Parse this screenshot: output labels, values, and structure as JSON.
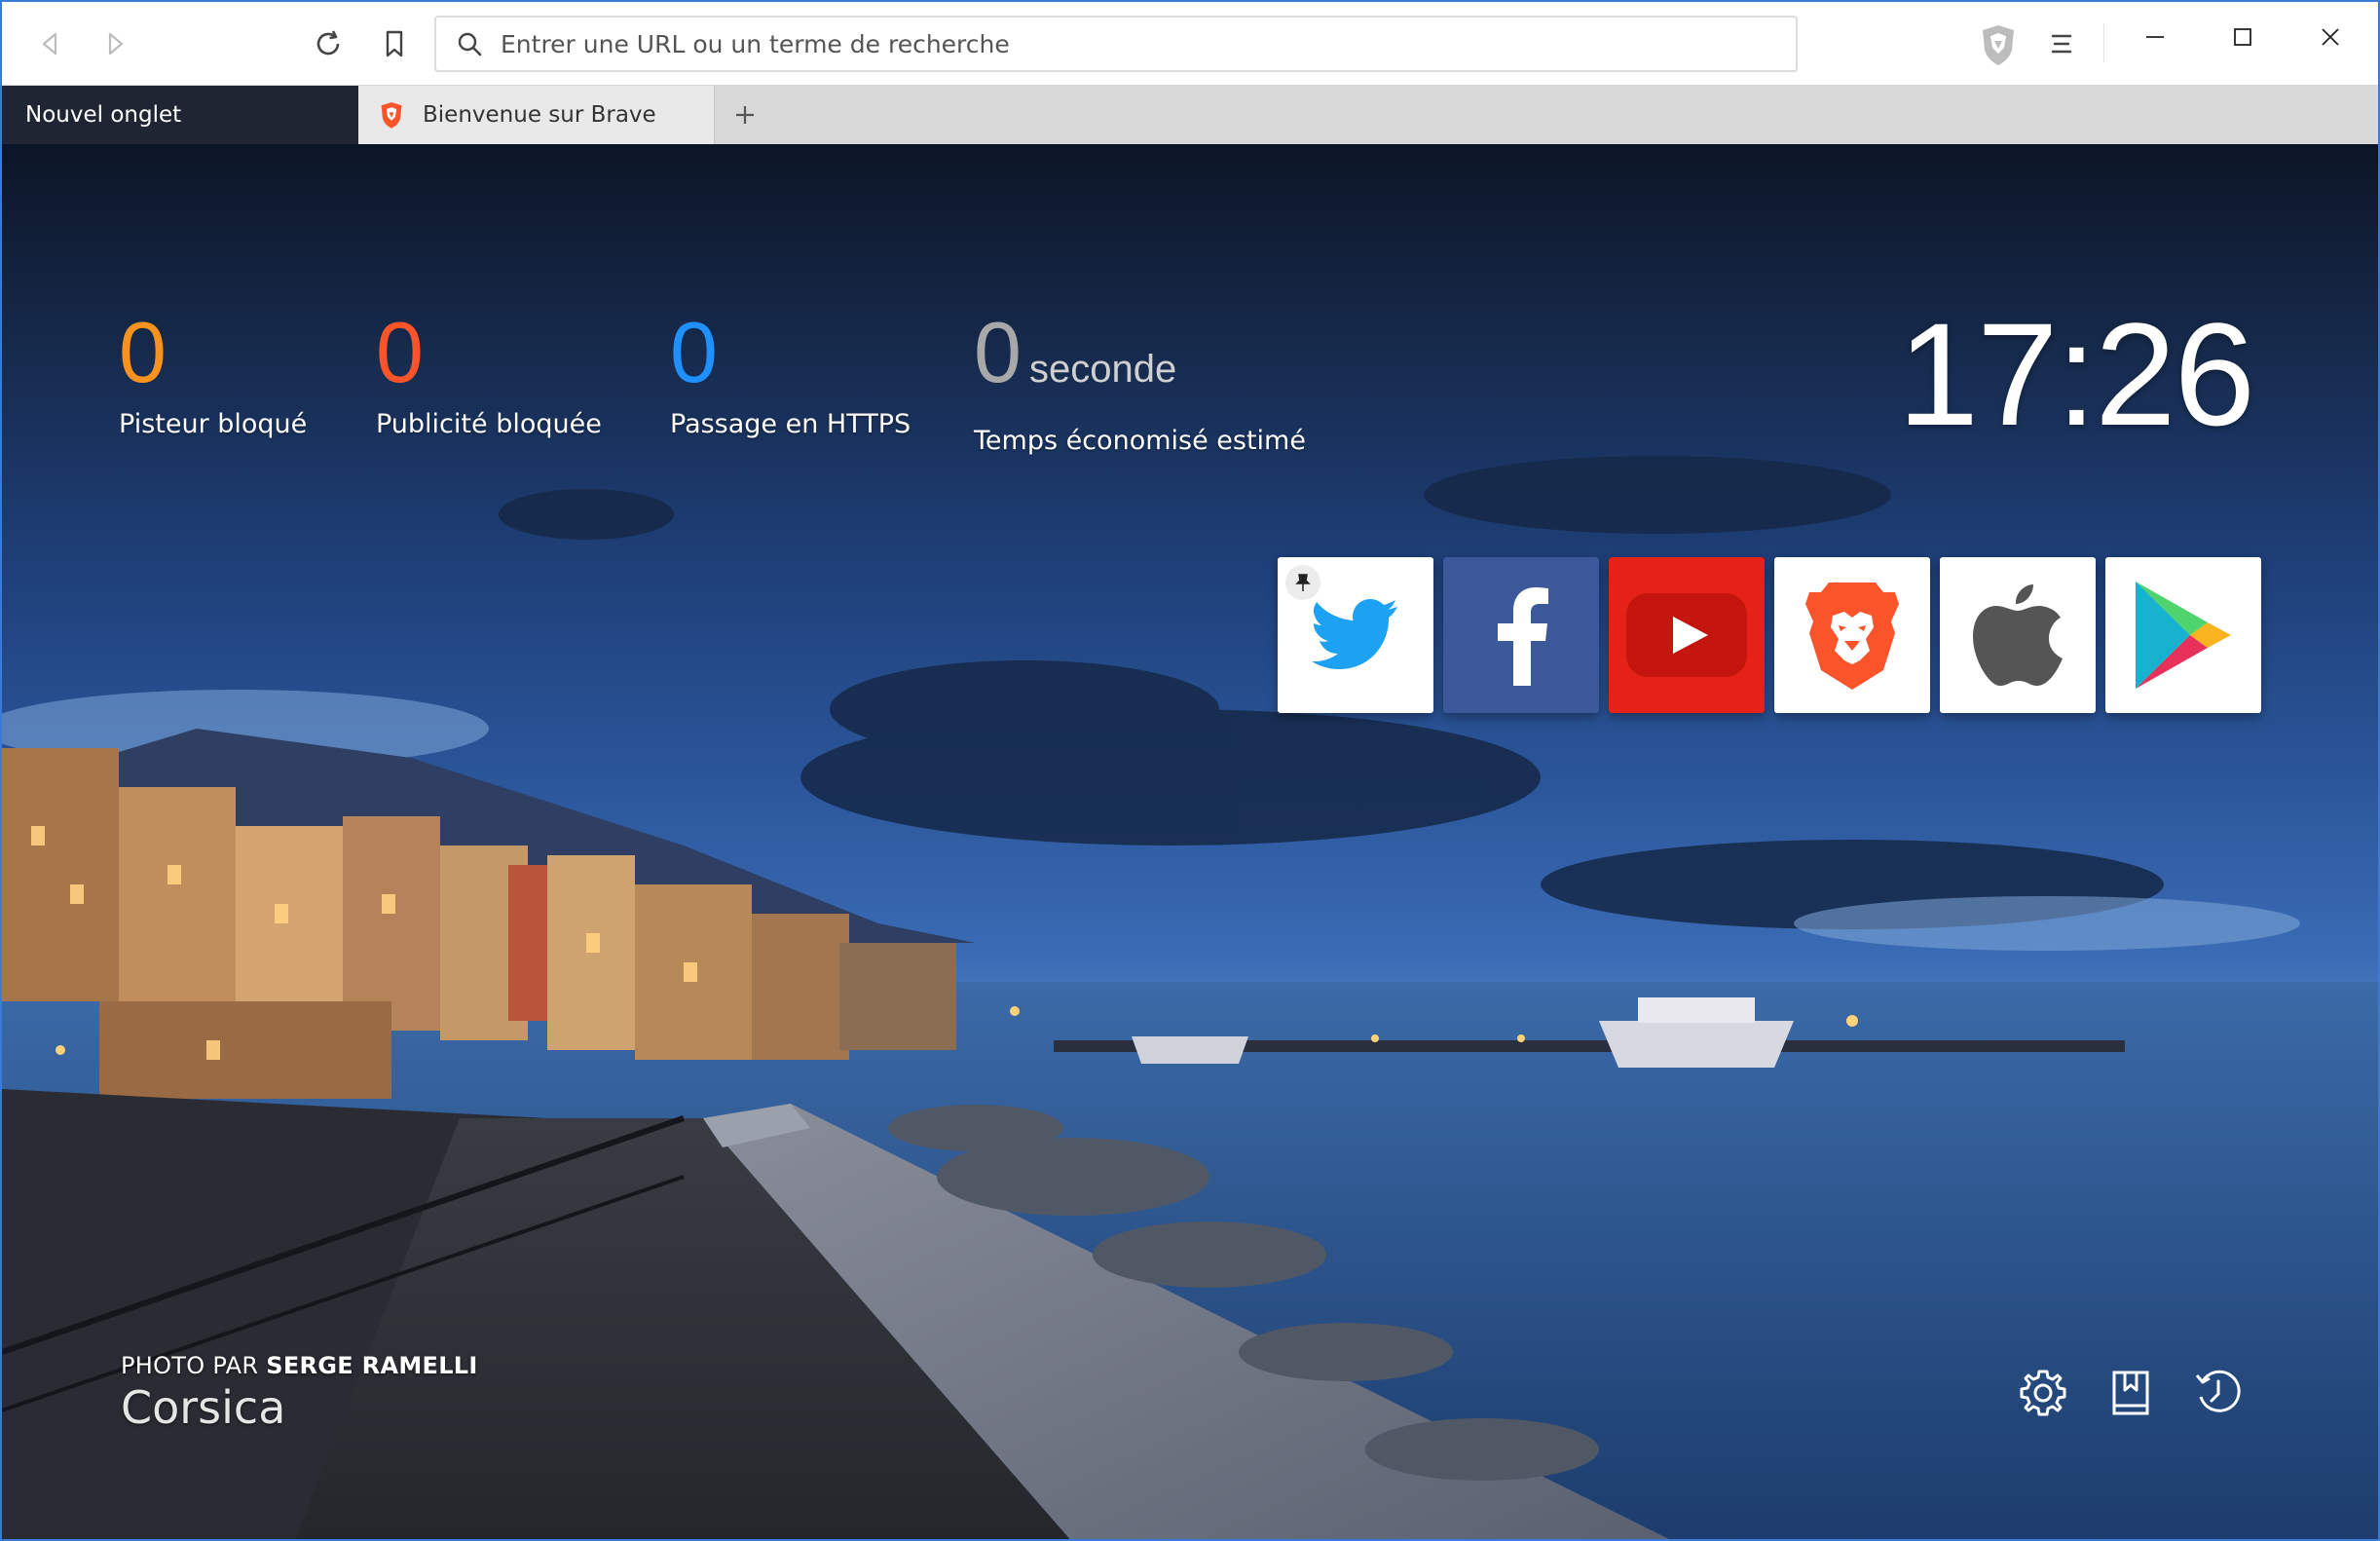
{
  "toolbar": {
    "url_placeholder": "Entrer une URL ou un terme de recherche"
  },
  "tabs": [
    {
      "label": "Nouvel onglet",
      "active": true
    },
    {
      "label": "Bienvenue sur Brave",
      "active": false
    }
  ],
  "stats": [
    {
      "value": "0",
      "label": "Pisteur bloqué",
      "color": "#f7931e"
    },
    {
      "value": "0",
      "label": "Publicité bloquée",
      "color": "#fb542b"
    },
    {
      "value": "0",
      "label": "Passage en HTTPS",
      "color": "#1e90ff"
    },
    {
      "value": "0",
      "unit": "seconde",
      "label": "Temps économisé estimé",
      "color": "#a8a8a8"
    }
  ],
  "clock": "17:26",
  "top_sites": [
    {
      "name": "twitter",
      "icon": "twitter-icon",
      "bg": "#ffffff",
      "pinned": true
    },
    {
      "name": "facebook",
      "icon": "facebook-icon",
      "bg": "#3b5998"
    },
    {
      "name": "youtube",
      "icon": "youtube-icon",
      "bg": "#e62117"
    },
    {
      "name": "brave",
      "icon": "brave-lion-icon",
      "bg": "#ffffff"
    },
    {
      "name": "apple",
      "icon": "apple-icon",
      "bg": "#ffffff"
    },
    {
      "name": "google-play",
      "icon": "google-play-icon",
      "bg": "#ffffff"
    }
  ],
  "credit": {
    "prefix": "PHOTO PAR ",
    "author": "SERGE RAMELLI",
    "place": "Corsica"
  },
  "footer_icons": [
    "settings-icon",
    "bookmarks-icon",
    "history-icon"
  ],
  "colors": {
    "accent": "#fb542b",
    "tab_active": "#1f2532",
    "window_border": "#3a7bd5"
  }
}
